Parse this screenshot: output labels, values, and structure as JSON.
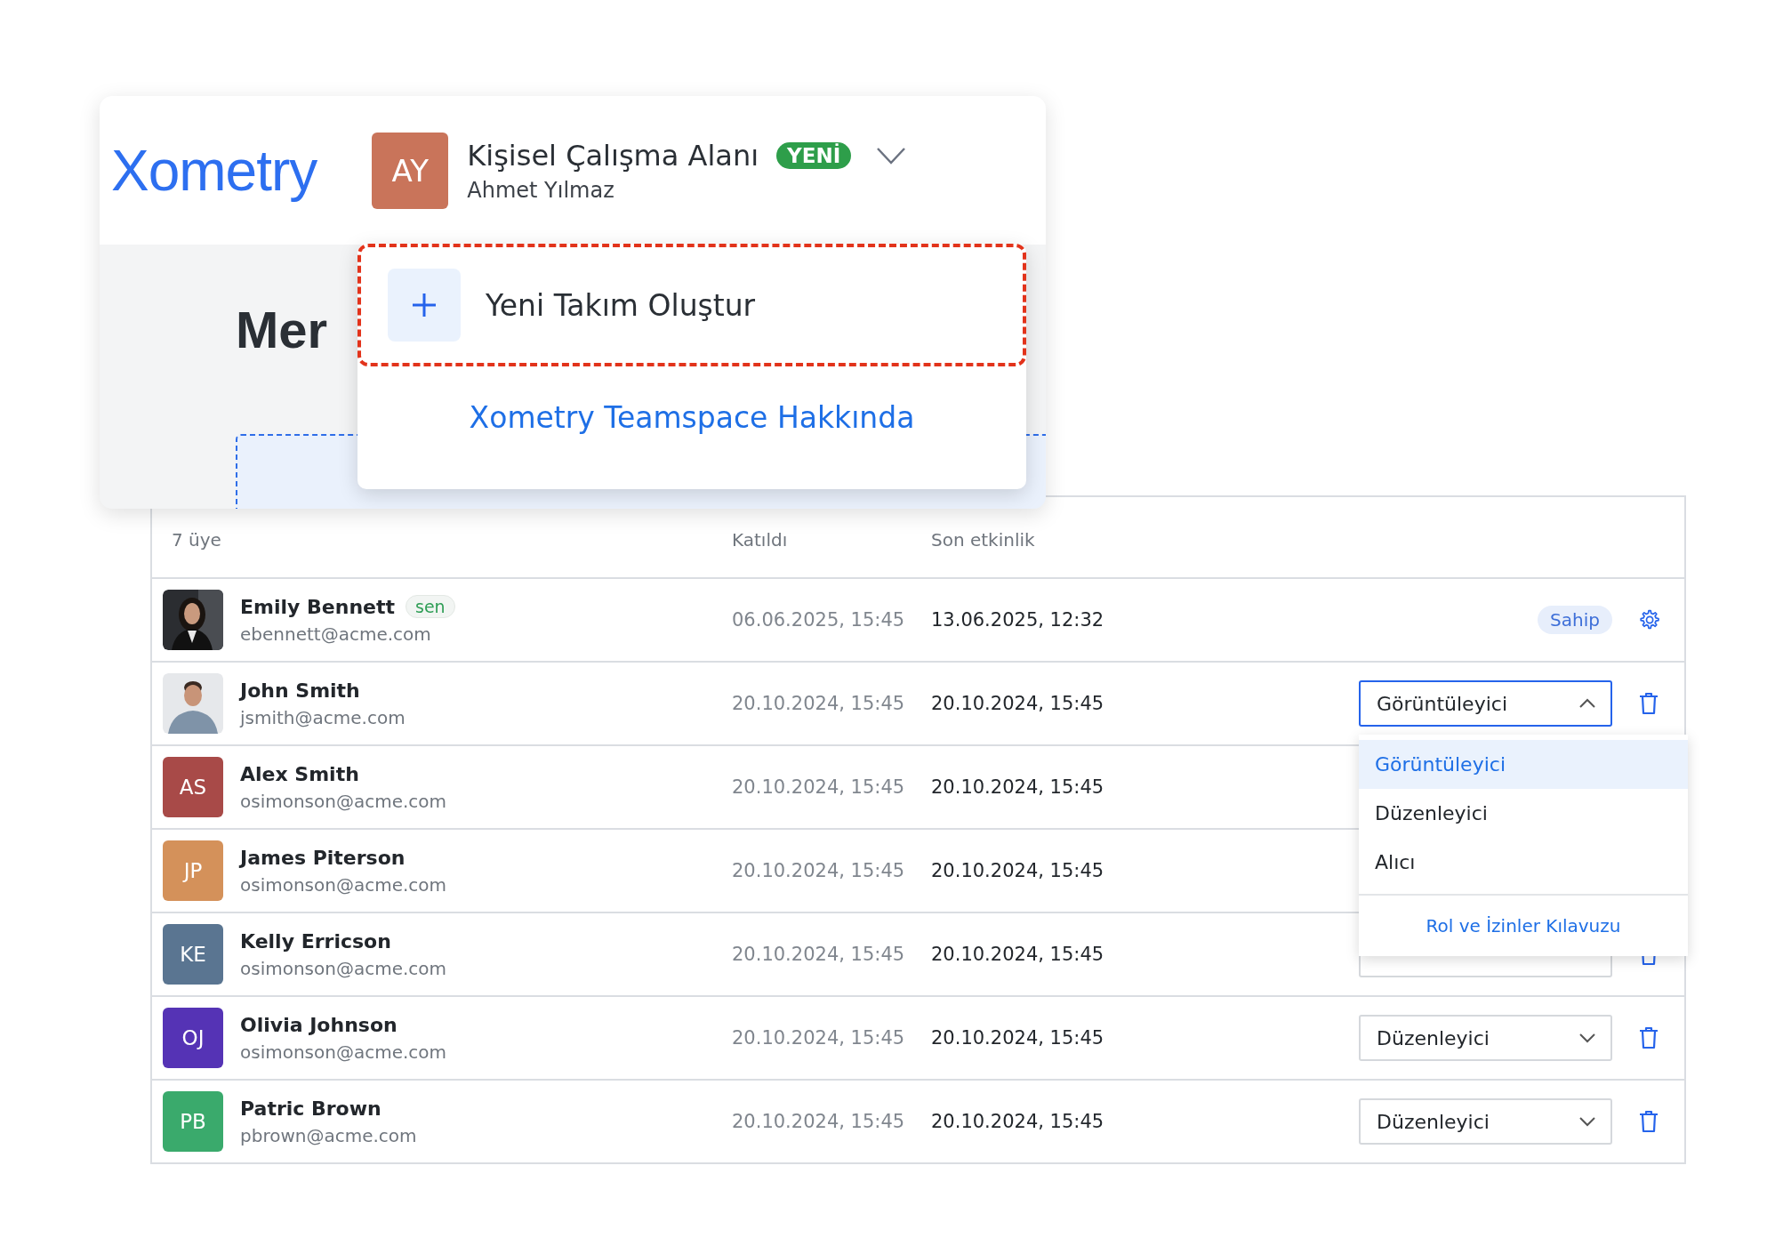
{
  "header": {
    "logo": "Xometry",
    "workspace": {
      "initials": "AY",
      "color": "#c9745a",
      "title": "Kişisel Çalışma Alanı",
      "badge": "YENİ",
      "owner": "Ahmet Yılmaz"
    }
  },
  "background": {
    "heading_start": "Mer"
  },
  "workspace_menu": {
    "items": [
      {
        "kind": "action",
        "label": "Yeni Takım Oluştur",
        "highlighted": true
      },
      {
        "kind": "link",
        "label": "Xometry Teamspace Hakkında"
      }
    ]
  },
  "members_table": {
    "count_label": "7 üye",
    "columns": [
      {
        "label": "Katıldı"
      },
      {
        "label": "Son etkinlik"
      }
    ],
    "rows": [
      {
        "name": "Emily Bennett",
        "you_tag": "sen",
        "email": "ebennett@acme.com",
        "joined": "06.06.2025, 15:45",
        "last_active": "13.06.2025, 12:32",
        "role": {
          "kind": "owner",
          "label": "Sahip"
        }
      },
      {
        "name": "John Smith",
        "email": "jsmith@acme.com",
        "joined": "20.10.2024, 15:45",
        "last_active": "20.10.2024, 15:45",
        "role": {
          "kind": "select",
          "value": "Görüntüleyici",
          "open": true
        }
      },
      {
        "name": "Alex Smith",
        "email": "osimonson@acme.com",
        "joined": "20.10.2024, 15:45",
        "last_active": "20.10.2024, 15:45",
        "avatar": {
          "kind": "initials",
          "text": "AS",
          "color": "#a84a48"
        }
      },
      {
        "name": "James Piterson",
        "email": "osimonson@acme.com",
        "joined": "20.10.2024, 15:45",
        "last_active": "20.10.2024, 15:45",
        "avatar": {
          "kind": "initials",
          "text": "JP",
          "color": "#d4915a"
        }
      },
      {
        "name": "Kelly Erricson",
        "email": "osimonson@acme.com",
        "joined": "20.10.2024, 15:45",
        "last_active": "20.10.2024, 15:45",
        "avatar": {
          "kind": "initials",
          "text": "KE",
          "color": "#5a7591"
        },
        "role": {
          "kind": "select",
          "open": false
        }
      },
      {
        "name": "Olivia Johnson",
        "email": "osimonson@acme.com",
        "joined": "20.10.2024, 15:45",
        "last_active": "20.10.2024, 15:45",
        "avatar": {
          "kind": "initials",
          "text": "OJ",
          "color": "#5533b5"
        },
        "role": {
          "kind": "select",
          "value": "Düzenleyici",
          "open": false
        }
      },
      {
        "name": "Patric Brown",
        "email": "pbrown@acme.com",
        "joined": "20.10.2024, 15:45",
        "last_active": "20.10.2024, 15:45",
        "avatar": {
          "kind": "initials",
          "text": "PB",
          "color": "#3aaa6c"
        },
        "role": {
          "kind": "select",
          "value": "Düzenleyici",
          "open": false
        }
      }
    ]
  },
  "role_menu": {
    "options": [
      {
        "label": "Görüntüleyici",
        "selected": true
      },
      {
        "label": "Düzenleyici",
        "selected": false
      },
      {
        "label": "Alıcı",
        "selected": false
      }
    ],
    "footer_link": "Rol ve İzinler Kılavuzu"
  }
}
